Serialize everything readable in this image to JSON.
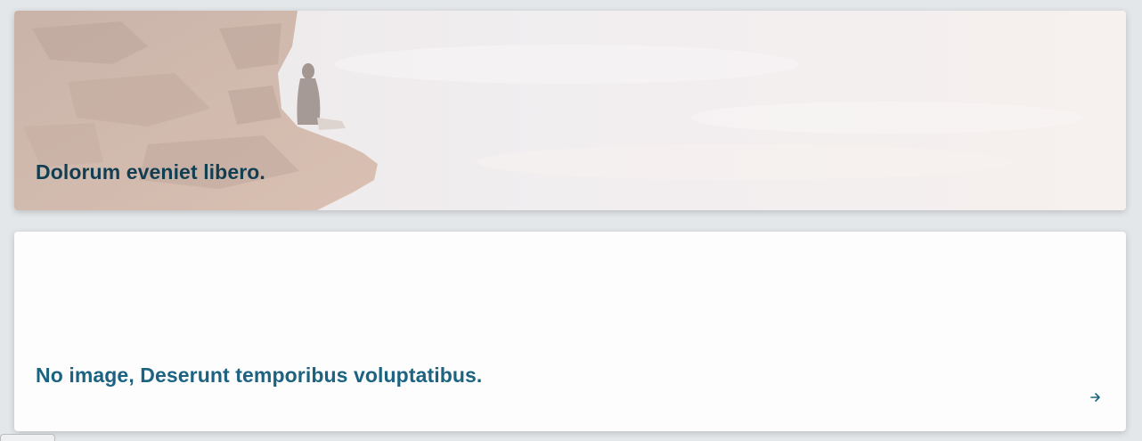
{
  "cards": [
    {
      "title": "Dolorum eveniet libero.",
      "has_image": true
    },
    {
      "title": "No image, Deserunt temporibus voluptatibus.",
      "has_image": false,
      "link_icon": "arrow-right-icon"
    }
  ],
  "colors": {
    "page_background": "#e4e7ea",
    "hero_title": "#123e52",
    "plain_title": "#1c6382",
    "card_background": "#fdfdfd"
  }
}
